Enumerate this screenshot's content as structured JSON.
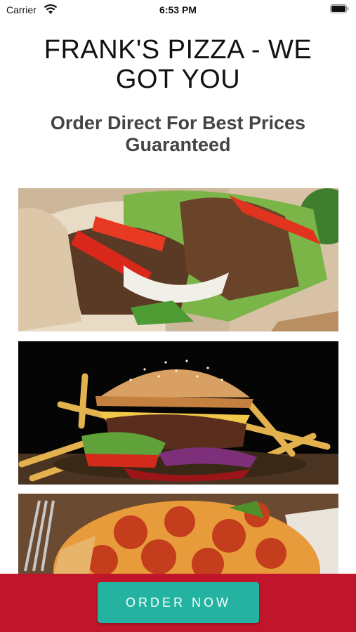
{
  "status_bar": {
    "carrier": "Carrier",
    "time": "6:53 PM"
  },
  "header": {
    "title": "FRANK'S PIZZA - WE GOT YOU",
    "subtitle": "Order Direct For Best Prices Guaranteed"
  },
  "photos": [
    {
      "subject": "gyro-pita"
    },
    {
      "subject": "burger-with-fries"
    },
    {
      "subject": "pepperoni-pizza"
    }
  ],
  "cta": {
    "label": "ORDER NOW",
    "bar_color": "#c0152b",
    "button_color": "#23b3a0"
  }
}
